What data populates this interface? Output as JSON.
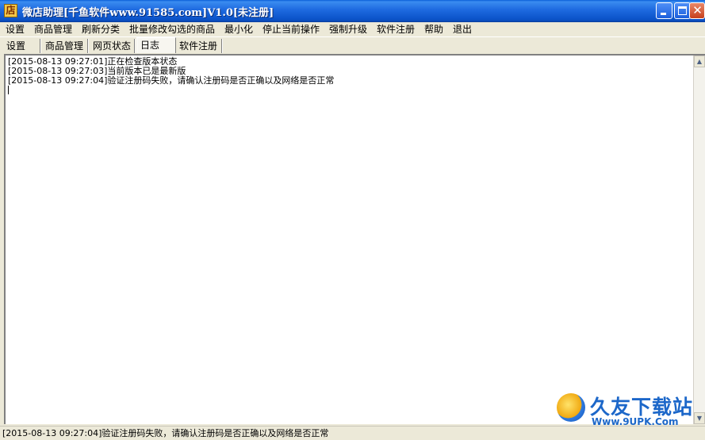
{
  "window": {
    "title": "微店助理[千鱼软件www.91585.com]V1.0[未注册]",
    "icon_char": "店",
    "close_char": "✕"
  },
  "menu": [
    "设置",
    "商品管理",
    "刷新分类",
    "批量修改勾选的商品",
    "最小化",
    "停止当前操作",
    "强制升级",
    "软件注册",
    "帮助",
    "退出"
  ],
  "tabs": [
    {
      "label": "设置",
      "active": false
    },
    {
      "label": "商品管理",
      "active": false
    },
    {
      "label": "网页状态",
      "active": false
    },
    {
      "label": "日志",
      "active": true
    },
    {
      "label": "软件注册",
      "active": false
    }
  ],
  "log": [
    "[2015-08-13 09:27:01]正在检查版本状态",
    "[2015-08-13 09:27:03]当前版本已是最新版",
    "[2015-08-13 09:27:04]验证注册码失败，请确认注册码是否正确以及网络是否正常"
  ],
  "status": "[2015-08-13 09:27:04]验证注册码失败，请确认注册码是否正确以及网络是否正常",
  "watermark": {
    "brand": "久友下载站",
    "url": "Www.9UPK.Com"
  },
  "colors": {
    "titlebar": "#0b53c8",
    "window_bg": "#ece9d8",
    "watermark": "#1c67c9"
  }
}
